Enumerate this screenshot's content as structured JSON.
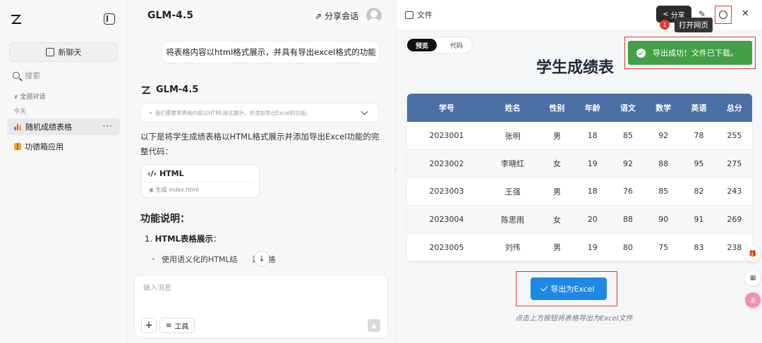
{
  "sidebar": {
    "new_chat": "新聊天",
    "search_placeholder": "搜索",
    "all_conversations": "全部对话",
    "today": "今天",
    "items": [
      {
        "label": "随机成绩表格",
        "more": "···"
      },
      {
        "label": "功德箱应用"
      }
    ]
  },
  "chat": {
    "title": "GLM-4.5",
    "share": "分享会话",
    "user_message": "将表格内容以html格式展示，并具有导出excel格式的功能",
    "model_name": "GLM-4.5",
    "thinking": "我们需要将表格内容以HTML格式展示，并添加导出Excel的功能。",
    "answer": "以下是将学生成绩表格以HTML格式展示并添加导出Excel功能的完整代码：",
    "code_card": {
      "title": "HTML",
      "status": "生成 index.html"
    },
    "features_title": "功能说明：",
    "list_number": "1.",
    "list_item_title": "HTML表格展示",
    "list_item_colon": "：",
    "list_sub_prefix": "使用语义化的HTML结",
    "list_sub_suffix": "建表格",
    "scroll_down": "↓",
    "input_placeholder": "输入消息",
    "tools": "工具"
  },
  "preview": {
    "file_label": "文件",
    "share": "分享",
    "tooltip": "打开网页",
    "badge": "1",
    "tabs": {
      "preview": "预览",
      "code": "代码"
    },
    "sheet_title": "学生成绩表",
    "toast": "导出成功！文件已下载。",
    "table": {
      "headers": [
        "学号",
        "姓名",
        "性别",
        "年龄",
        "语文",
        "数学",
        "英语",
        "总分"
      ],
      "rows": [
        [
          "2023001",
          "张明",
          "男",
          "18",
          "85",
          "92",
          "78",
          "255"
        ],
        [
          "2023002",
          "李晓红",
          "女",
          "19",
          "92",
          "88",
          "95",
          "275"
        ],
        [
          "2023003",
          "王强",
          "男",
          "18",
          "76",
          "85",
          "82",
          "243"
        ],
        [
          "2023004",
          "陈思雨",
          "女",
          "20",
          "88",
          "90",
          "91",
          "269"
        ],
        [
          "2023005",
          "刘伟",
          "男",
          "19",
          "80",
          "75",
          "83",
          "238"
        ]
      ]
    },
    "export_button": "导出为Excel",
    "hint": "点击上方按钮将表格导出为Excel文件",
    "float_icons": [
      "gift-icon",
      "grid-icon",
      "translate-icon"
    ]
  },
  "colors": {
    "header_blue": "#4a6fa5",
    "export_blue": "#1e88e5",
    "toast_green": "#43a047",
    "highlight_red": "#e53935"
  }
}
